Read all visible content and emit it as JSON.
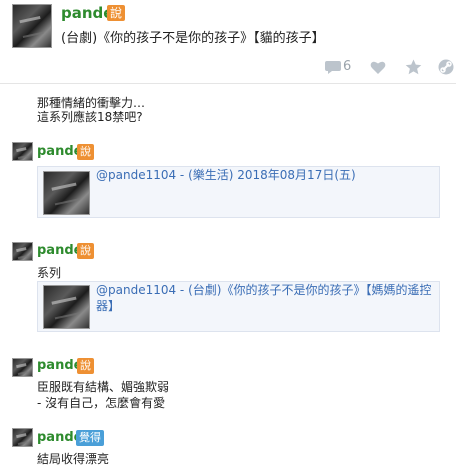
{
  "header": {
    "username": "pande",
    "badge": "說",
    "title": "(台劇)《你的孩子不是你的孩子》【貓的孩子】",
    "comment_count": "6"
  },
  "posts": [
    {
      "lines": [
        "那種情緒的衝擊力…",
        "這系列應該18禁吧?"
      ]
    },
    {
      "username": "pande",
      "badge": "說",
      "quote": "@pande1104 - (樂生活) 2018年08月17日(五)"
    },
    {
      "username": "pande",
      "badge": "說",
      "text": "系列",
      "quote_line1": "@pande1104 - (台劇)《你的孩子不是你的孩子》【媽媽的遙控",
      "quote_line2": "器】"
    },
    {
      "username": "pande",
      "badge": "說",
      "line1": "臣服既有結構、媚強欺弱",
      "line2": "- 沒有自己，怎麼會有愛"
    },
    {
      "username": "pande",
      "badge": "覺得",
      "text": "結局收得漂亮"
    }
  ],
  "icons": {
    "comment": "comment-icon",
    "like": "heart-icon",
    "favorite": "star-icon",
    "share": "link-icon"
  },
  "colors": {
    "username": "#2e8b2e",
    "say_badge": "#ee9033",
    "feel_badge": "#4a9fd8",
    "quote_link": "#3a6db5"
  }
}
